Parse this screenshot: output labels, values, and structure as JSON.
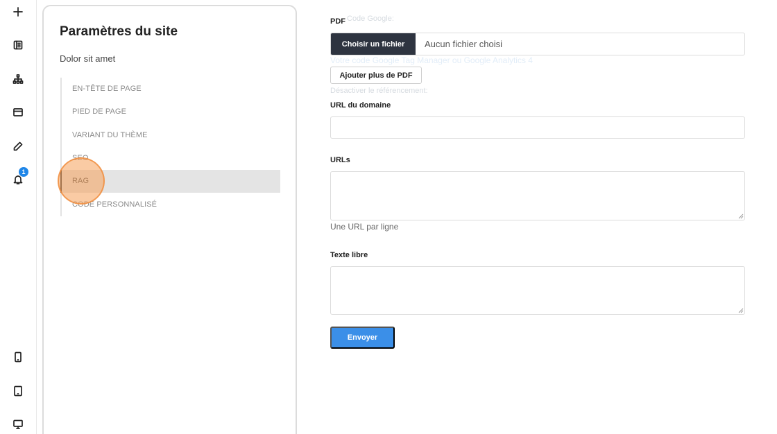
{
  "rail": {
    "top": [
      "add",
      "pages",
      "sitemap",
      "layout",
      "edit",
      "notifications"
    ],
    "notification_count": "1",
    "bottom": [
      "mobile-preview",
      "tablet-preview",
      "desktop-preview"
    ]
  },
  "settings": {
    "title": "Paramètres du site",
    "subtitle": "Dolor sit amet",
    "nav": [
      {
        "label": "EN-TÊTE DE PAGE"
      },
      {
        "label": "PIED DE PAGE"
      },
      {
        "label": "VARIANT DU THÈME"
      },
      {
        "label": "SEO"
      },
      {
        "label": "RAG",
        "active": true
      },
      {
        "label": "CODE PERSONNALISÉ"
      }
    ]
  },
  "form": {
    "ghost_google": "Code Google:",
    "ghost_gtm": "Votre code Google Tag Manager ou Google Analytics 4",
    "ghost_noindex": "Désactiver le référencement:",
    "pdf_label": "PDF",
    "file_button": "Choisir un fichier",
    "file_status": "Aucun fichier choisi",
    "add_pdf": "Ajouter plus de PDF",
    "domain_label": "URL du domaine",
    "domain_value": "",
    "urls_label": "URLs",
    "urls_value": "",
    "urls_help": "Une URL par ligne",
    "text_label": "Texte libre",
    "text_value": "",
    "submit": "Envoyer"
  },
  "colors": {
    "primary": "#3b8fe8",
    "dark_button": "#2e3440",
    "badge": "#1f86e8",
    "active_bg": "#e4e4e4"
  }
}
